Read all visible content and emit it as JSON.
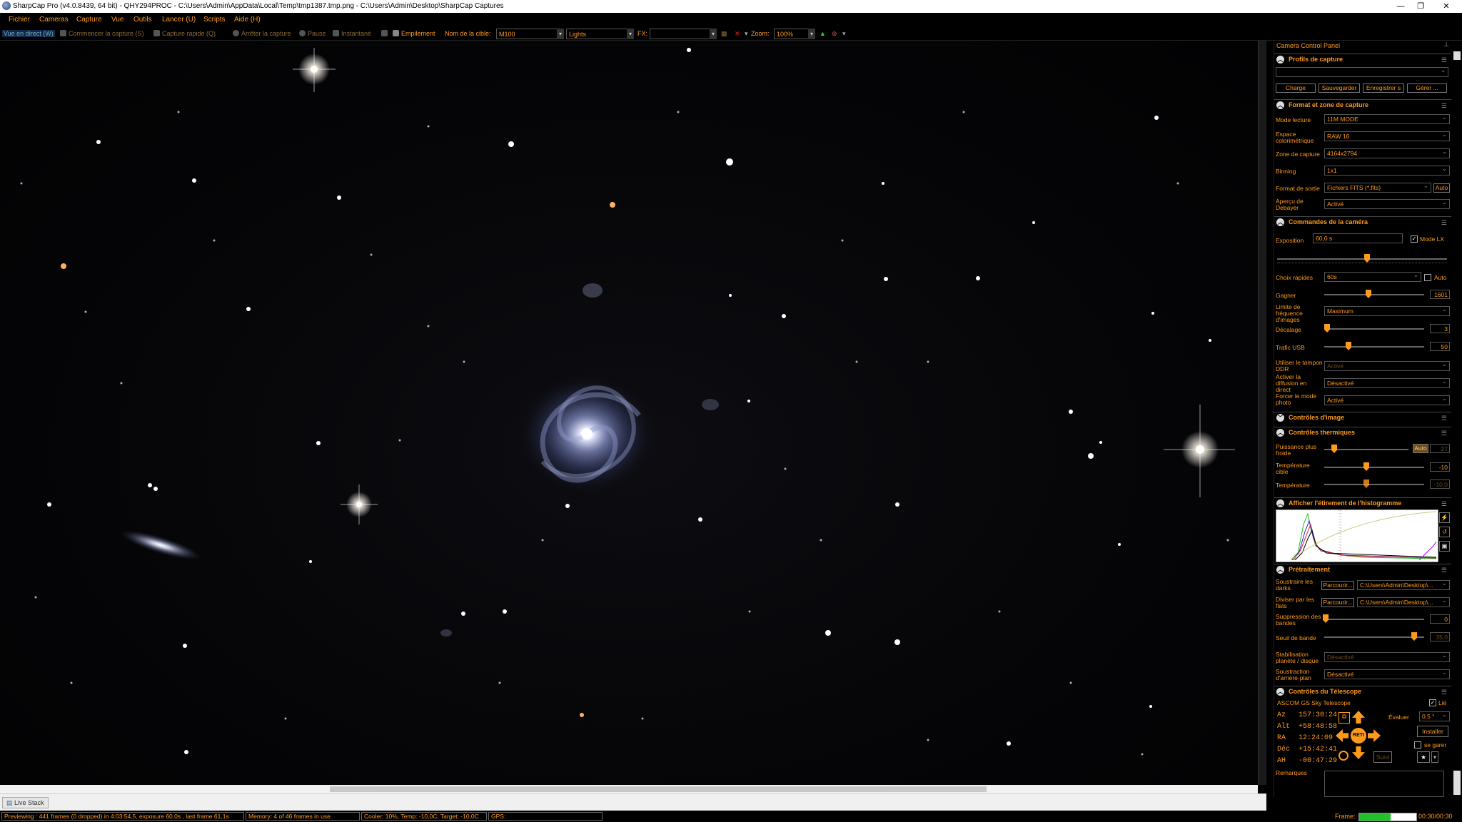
{
  "window": {
    "title": "SharpCap Pro (v4.0.8439, 64 bit) - QHY294PROC - C:\\Users\\Admin\\AppData\\Local\\Temp\\tmp1387.tmp.png - C:\\Users\\Admin\\Desktop\\SharpCap Captures"
  },
  "menu": [
    "Fichier",
    "Cameras",
    "Capture",
    "Vue",
    "Outils",
    "Lancer (U)",
    "Scripts",
    "Aide (H)"
  ],
  "toolbar": {
    "live_view": "Vue en direct (W)",
    "start_capture": "Commencer la capture (S)",
    "quick_capture": "Capture rapide (Q)",
    "stop_capture": "Arrêter la capture",
    "pause": "Pause",
    "snapshot": "Instantané",
    "stacking": "Empilement",
    "target_label": "Nom de la cible:",
    "target_value": "M100",
    "frame_type": "Lights",
    "fx_label": "FX:",
    "zoom_label": "Zoom:",
    "zoom_value": "100%"
  },
  "panel": {
    "title": "Camera Control Panel",
    "pin": "⊥",
    "profiles": {
      "title": "Profils de capture",
      "buttons": [
        "Charge",
        "Sauvegarder",
        "Enregistrer s",
        "Gérer ..."
      ]
    },
    "format": {
      "title": "Format et zone de capture",
      "rows": [
        {
          "label": "Mode lecture",
          "value": "11M MODE"
        },
        {
          "label": "Espace colorimétrique",
          "value": "RAW 16"
        },
        {
          "label": "Zone de capture",
          "value": "4164x2794"
        },
        {
          "label": "Binning",
          "value": "1x1"
        },
        {
          "label": "Format de sortie",
          "value": "Fichiers FITS (*.fits)",
          "extra": "Auto"
        },
        {
          "label": "Aperçu de Debayer",
          "value": "Activé"
        }
      ]
    },
    "camera": {
      "title": "Commandes de la caméra",
      "exposure_label": "Exposition",
      "exposure_value": "60,0 s",
      "lx_label": "Mode LX",
      "quick_label": "Choix rapides",
      "quick_value": "60s",
      "auto_label": "Auto",
      "gain_label": "Gagner",
      "gain_value": "1601",
      "framerate_label": "Limite de fréquence d'images",
      "framerate_value": "Maximum",
      "offset_label": "Décalage",
      "offset_value": "3",
      "usb_label": "Trafic USB",
      "usb_value": "50",
      "ddr_label": "Utiliser le tampon DDR",
      "ddr_value": "Activé",
      "stream_label": "Activer la diffusion en direct",
      "stream_value": "Désactivé",
      "still_label": "Forcer le mode photo",
      "still_value": "Activé"
    },
    "image_controls": {
      "title": "Contrôles d'image"
    },
    "thermal": {
      "title": "Contrôles thermiques",
      "cooler_label": "Puissance plus froide",
      "cooler_auto": "Auto",
      "cooler_value": "27",
      "target_label": "Température cible",
      "target_value": "-10",
      "temp_label": "Température",
      "temp_value": "-10,0"
    },
    "histogram": {
      "title": "Afficher l'étirement de l'histogramme"
    },
    "preprocess": {
      "title": "Prétraitement",
      "dark_label": "Soustraire les darks",
      "flat_label": "Diviser par les flats",
      "browse": "Parcourir...",
      "dark_path": "C:\\Users\\Admin\\Desktop\\...",
      "flat_path": "C:\\Users\\Admin\\Desktop\\...",
      "banding_label": "Suppression des bandes",
      "banding_value": "0",
      "threshold_label": "Seuil de bande",
      "threshold_value": "35,0",
      "stab_label": "Stabilisation planète / disque",
      "stab_value": "Désactivé",
      "bg_label": "Soustraction d'arrière-plan",
      "bg_value": "Désactivé"
    },
    "telescope": {
      "title": "Contrôles du Télescope",
      "name": "ASCOM GS Sky Telescope",
      "linked": "Lié",
      "coords": [
        {
          "k": "Az",
          "v": "157:30:24"
        },
        {
          "k": "Alt",
          "v": "+58:48:58"
        },
        {
          "k": "RA",
          "v": "12:24:09"
        },
        {
          "k": "Déc",
          "v": "+15:42:41"
        },
        {
          "k": "AH",
          "v": "-00:47:29"
        }
      ],
      "rate_label": "Évaluer",
      "rate_value": "0.5 °",
      "setup": "Installer",
      "park": "se garer",
      "track": "Suivi",
      "center": "RETI"
    },
    "notes_label": "Remarques"
  },
  "livestack": "Live Stack",
  "status": {
    "preview": "Previewing : 441 frames (0 dropped) in 4:03:54,5, exposure 60,0s , last frame 61,1s",
    "memory": "Memory: 4 of 46 frames in use.",
    "cooler": "Cooler: 10%, Temp: -10,0C, Target: -10,0C",
    "gps": "GPS:",
    "frame_label": "Frame:",
    "frame_time": "00:30/00:30",
    "frame_progress": 0.55
  }
}
